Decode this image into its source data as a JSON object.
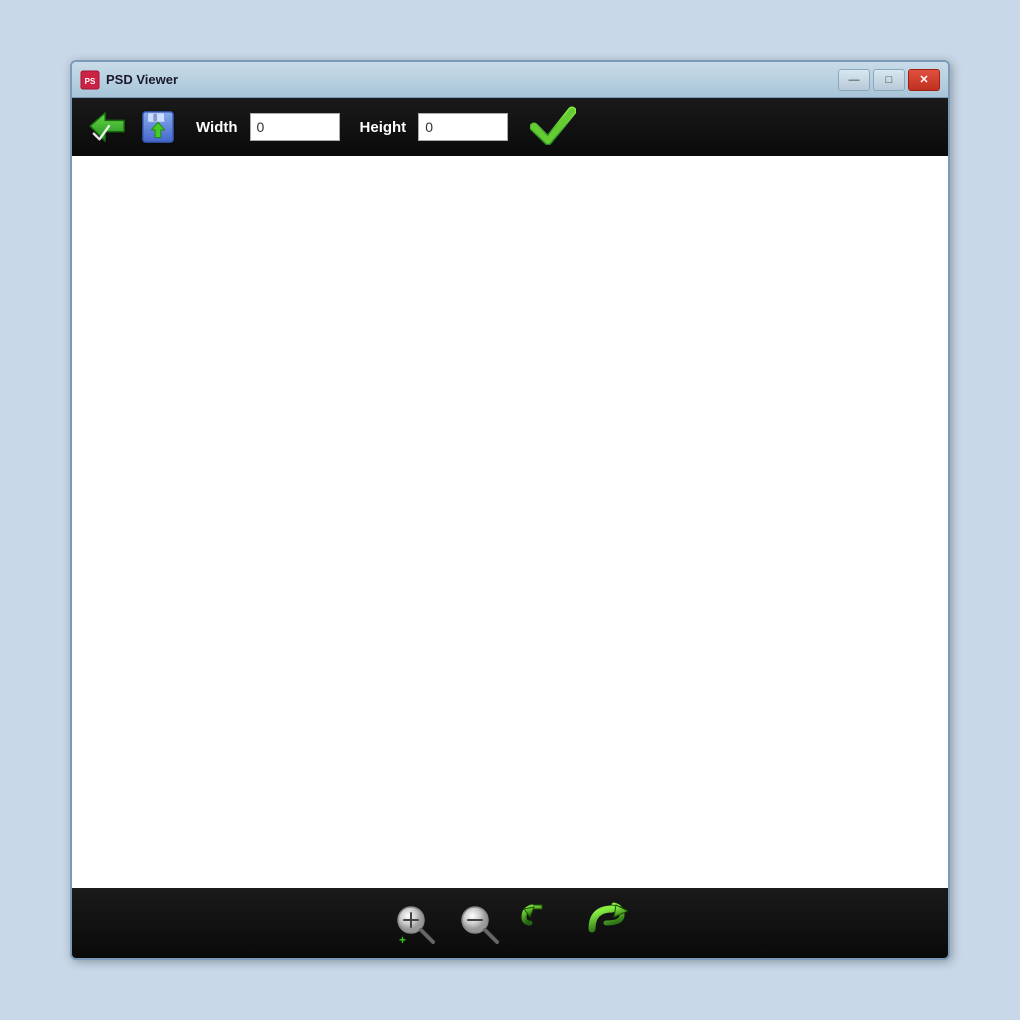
{
  "window": {
    "title": "PSD Viewer",
    "app_icon": "🎨"
  },
  "title_buttons": {
    "minimize": "—",
    "maximize": "□",
    "close": "✕"
  },
  "toolbar": {
    "width_label": "Width",
    "height_label": "Height",
    "width_value": "0",
    "height_value": "0"
  },
  "bottom_toolbar": {
    "zoom_in_label": "zoom-in",
    "zoom_out_label": "zoom-out",
    "rotate_left_label": "rotate-left",
    "rotate_right_label": "rotate-right"
  }
}
